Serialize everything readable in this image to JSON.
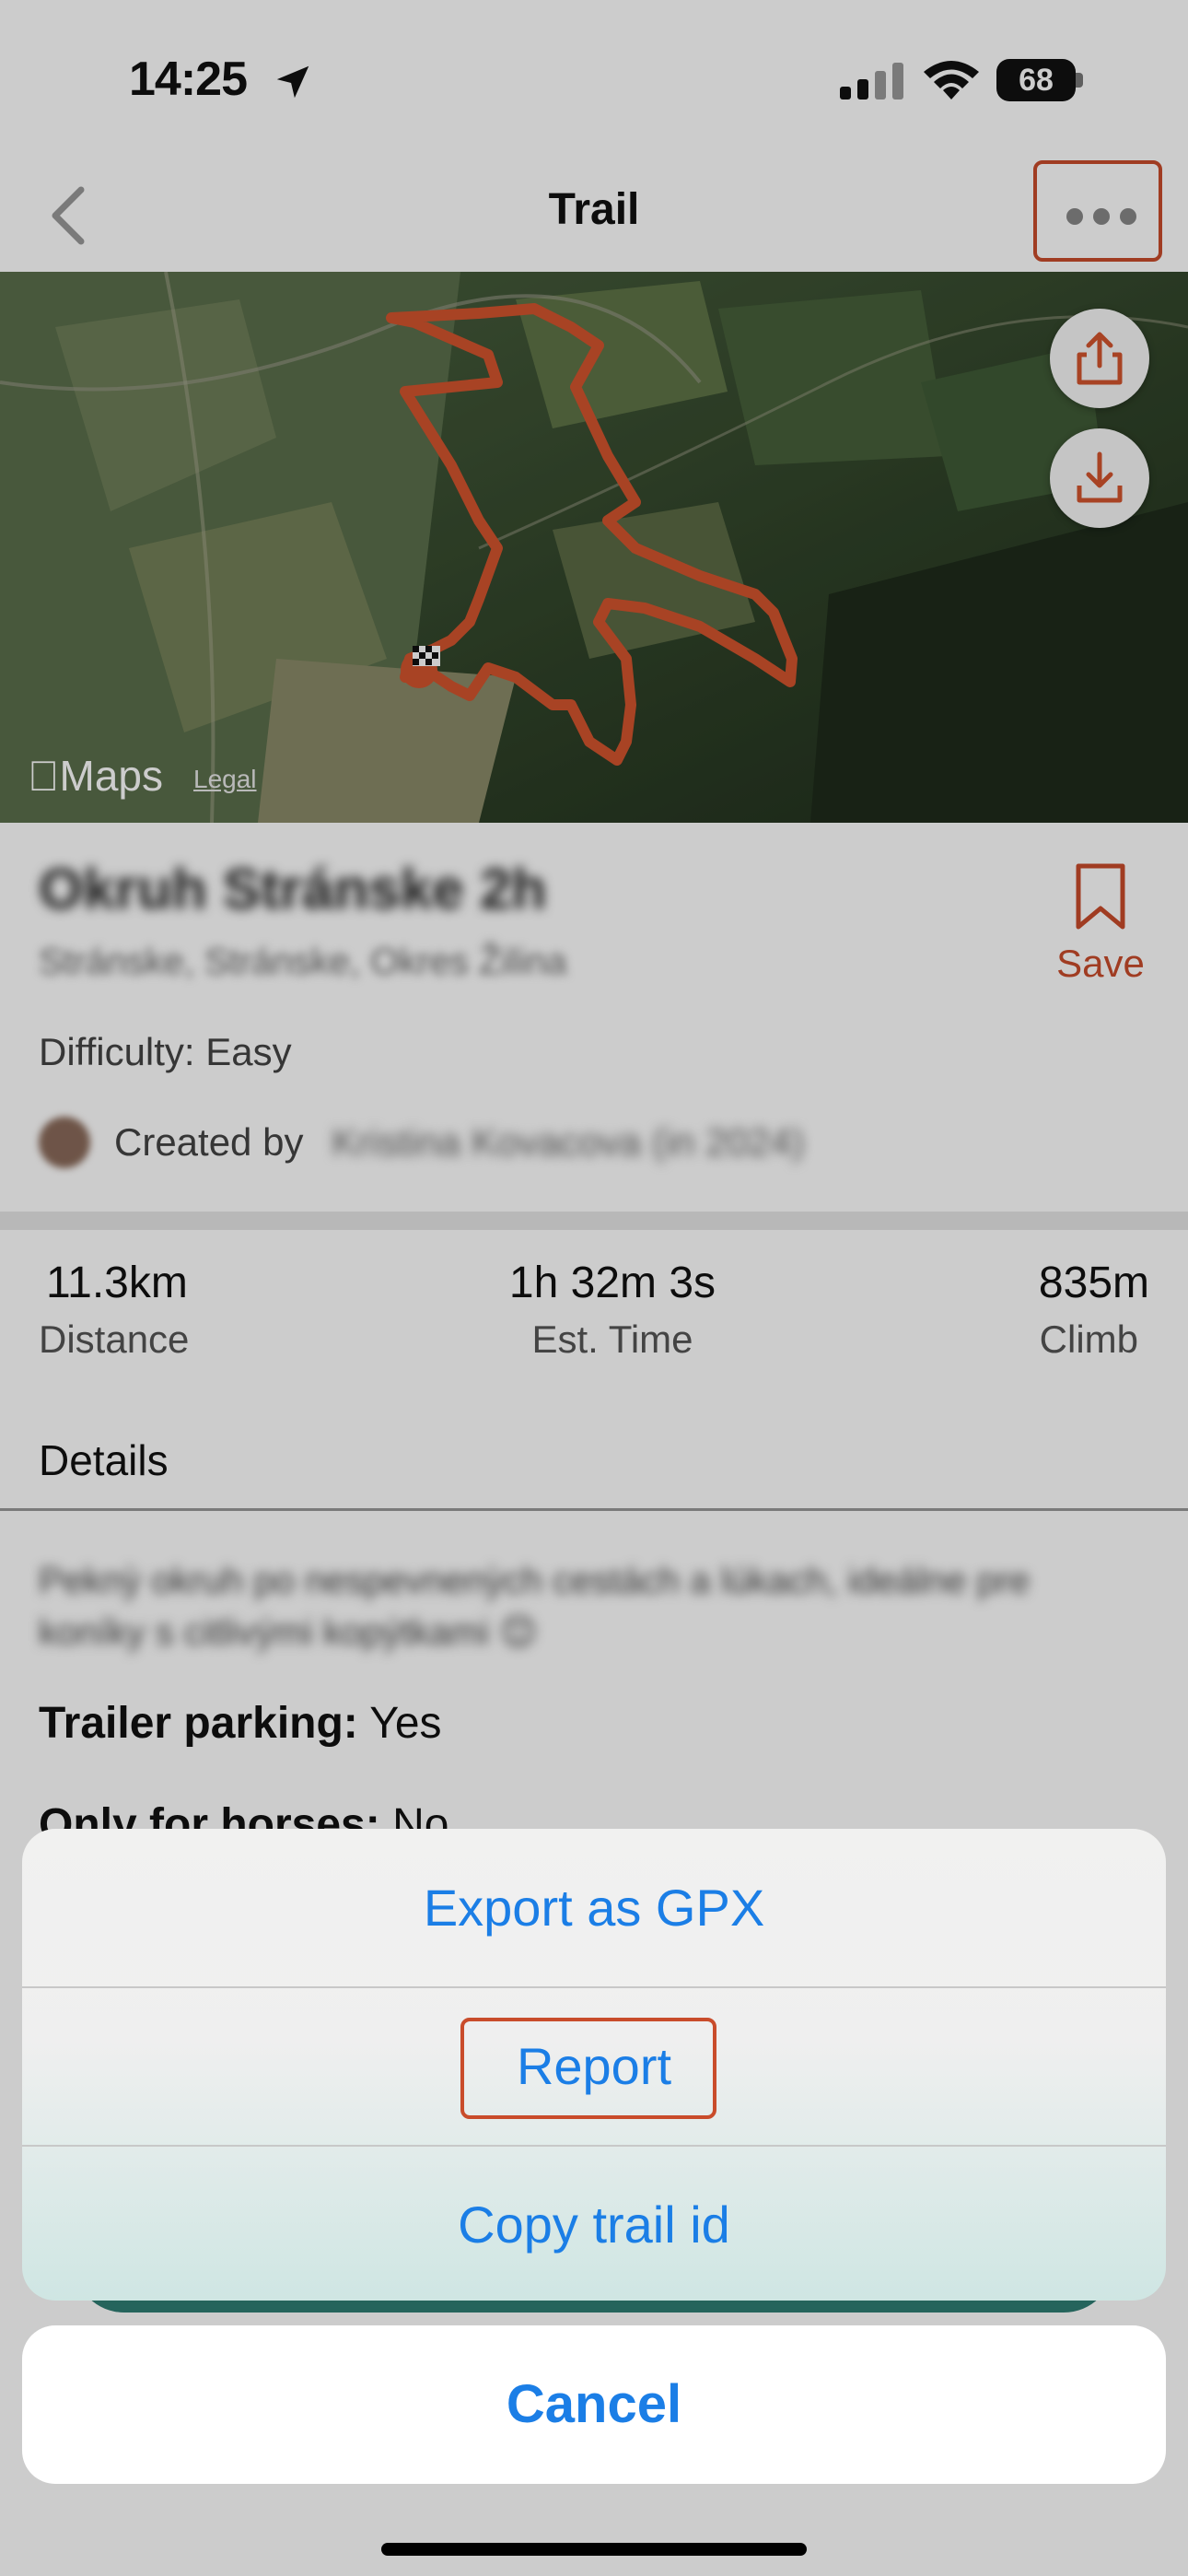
{
  "status_bar": {
    "time": "14:25",
    "battery": "68"
  },
  "nav": {
    "title": "Trail"
  },
  "map": {
    "attribution": "Maps",
    "legal": "Legal"
  },
  "trail": {
    "name": "Okruh Stránske 2h",
    "location": "Stránske, Stránske, Okres Žilina",
    "save_label": "Save",
    "difficulty": "Difficulty: Easy",
    "created_by_label": "Created by",
    "creator": "Kristina Kovacova (in 2024)"
  },
  "stats": [
    {
      "value": "11.3km",
      "label": "Distance"
    },
    {
      "value": "1h 32m 3s",
      "label": "Est. Time"
    },
    {
      "value": "835m",
      "label": "Climb"
    }
  ],
  "details": {
    "header": "Details",
    "description": "Peknỳ okruh po nespevnenỳch cestách a lúkach, ideálne pre koníky s citlivými kopýtkami 😊",
    "trailer_parking_label": "Trailer parking:",
    "trailer_parking_value": "Yes",
    "only_horses_label": "Only for horses:",
    "only_horses_value": "No"
  },
  "action_sheet": {
    "items": [
      "Export as GPX",
      "Report",
      "Copy trail id"
    ],
    "cancel": "Cancel"
  },
  "colors": {
    "accent": "#c94c2b",
    "ios_blue": "#1b7ee6",
    "route": "#d2542e"
  }
}
